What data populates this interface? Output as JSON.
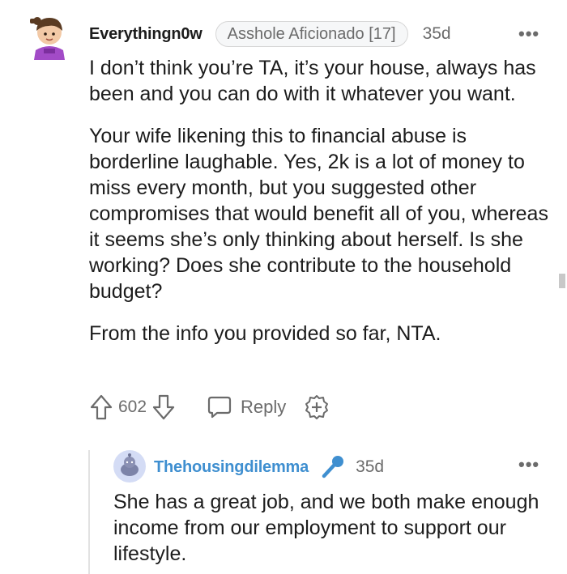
{
  "comment": {
    "author": "Everythingn0w",
    "flair": "Asshole Aficionado [17]",
    "age": "35d",
    "more_label": "•••",
    "paragraphs": [
      "I don’t think you’re TA, it’s your house, always has been and you can do with it whatever you want.",
      "Your wife likening this to financial abuse is borderline laughable. Yes, 2k is a lot of money to miss every month, but you suggested other compromises that would benefit all of you, whereas it seems she’s only thinking about herself. Is she working? Does she contribute to the household budget?",
      "From the info you provided so far, NTA."
    ],
    "votes": "602",
    "reply_label": "Reply"
  },
  "reply": {
    "author": "Thehousingdilemma",
    "age": "35d",
    "more_label": "•••",
    "text": "She has a great job, and we both make enough income from our employment to support our lifestyle."
  },
  "icons": {
    "upvote": "upvote-arrow-icon",
    "downvote": "downvote-arrow-icon",
    "reply": "speech-bubble-icon",
    "award": "add-award-icon",
    "op_badge": "microphone-icon"
  },
  "colors": {
    "op_name": "#3f8fd0",
    "meta_gray": "#6b6b6b",
    "flair_bg": "#f6f7f8",
    "avatar_purple": "#a24bc7"
  }
}
